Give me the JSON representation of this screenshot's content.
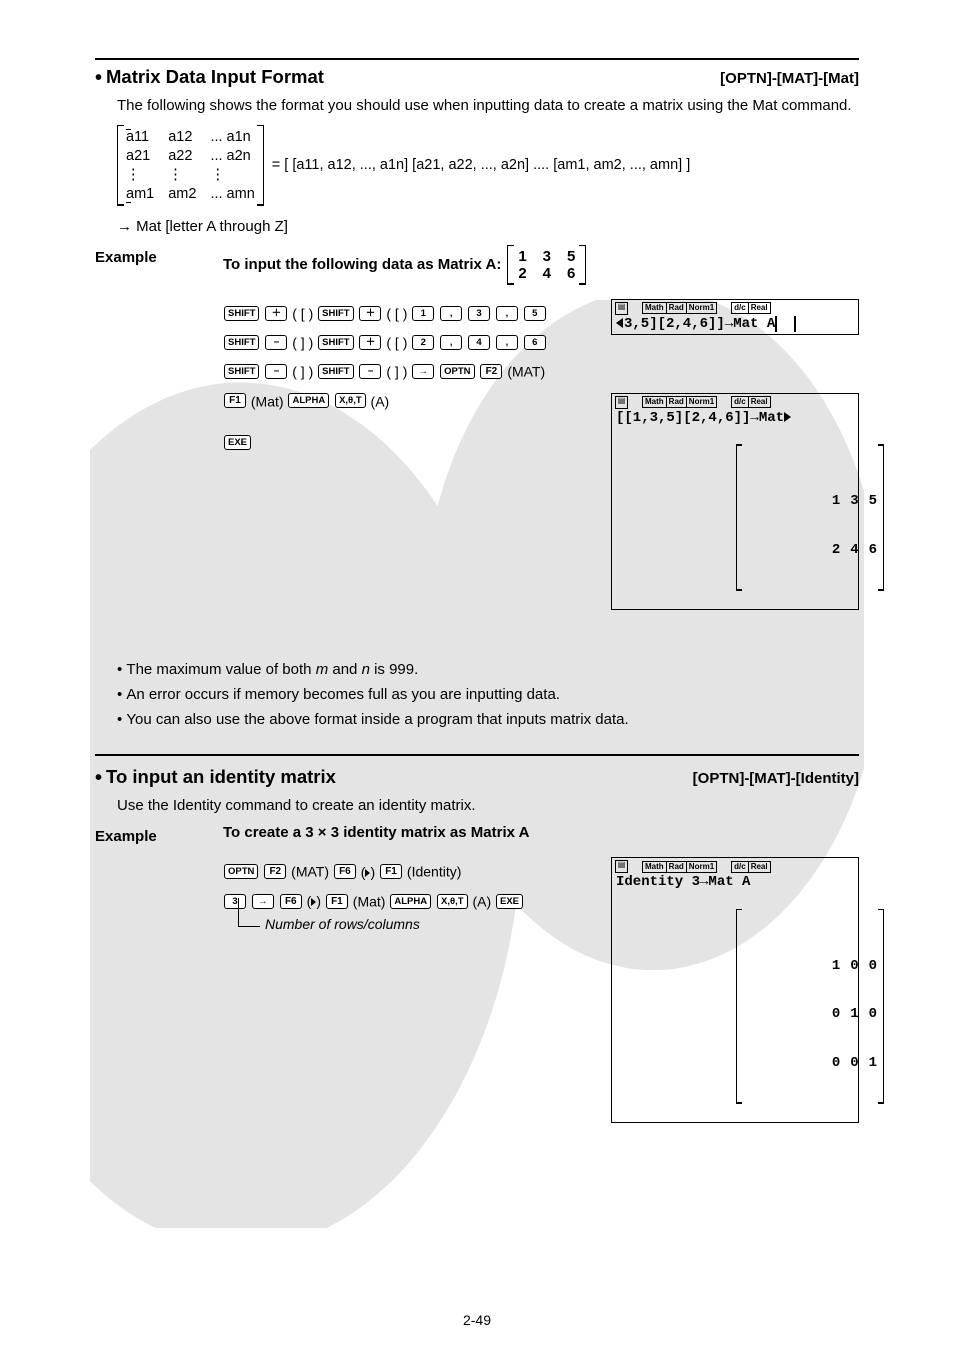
{
  "section1": {
    "title": "Matrix Data Input Format",
    "path": "[OPTN]-[MAT]-[Mat]",
    "intro": "The following shows the format you should use when inputting data to create a matrix using the Mat command.",
    "matrix_cells": [
      "a11",
      "a12",
      "... a1n",
      "a21",
      "a22",
      "... a2n",
      "⋮",
      "⋮",
      "      ⋮",
      "am1",
      "am2",
      "... amn"
    ],
    "rhs": "= [ [a11, a12, ..., a1n] [a21, a22, ..., a2n] .... [am1, am2, ..., amn] ]",
    "arrow_line": "→ Mat [letter A through Z]",
    "example_label": "Example",
    "example_prompt": "To input the following data as Matrix A:",
    "example_matrix": [
      [
        "1",
        "3",
        "5"
      ],
      [
        "2",
        "4",
        "6"
      ]
    ],
    "keylines": {
      "l1_part1": "( [ )",
      "l1_part2": "( [ )",
      "l2_part1": "( ] )",
      "l2_part2": "( [ )",
      "l3_part1": "( ] )",
      "l3_part2": "( ] )",
      "l3_suffix": "(MAT)",
      "l4_suffix": "(Mat)",
      "l4_end": "(A)"
    },
    "keys": {
      "shift": "SHIFT",
      "plus": "＋",
      "minus": "−",
      "one": "1",
      "two": "2",
      "three": "3",
      "four": "4",
      "five": "5",
      "six": "6",
      "comma": ",",
      "arrow": "→",
      "optn": "OPTN",
      "f1": "F1",
      "f2": "F2",
      "f6": "F6",
      "alpha": "ALPHA",
      "xot": "X,θ,T",
      "exe": "EXE"
    },
    "screen1": {
      "badges_a": [
        "Math",
        "Rad",
        "Norm1"
      ],
      "badges_b": [
        "d/c",
        "Real"
      ],
      "line": "3,5][2,4,6]]→Mat A"
    },
    "screen2": {
      "badges_a": [
        "Math",
        "Rad",
        "Norm1"
      ],
      "badges_b": [
        "d/c",
        "Real"
      ],
      "line1": "[[1,3,5][2,4,6]]→Mat",
      "result": [
        [
          "1",
          "3",
          "5"
        ],
        [
          "2",
          "4",
          "6"
        ]
      ]
    },
    "notes": [
      "The maximum value of both m and n is 999.",
      "An error occurs if memory becomes full as you are inputting data.",
      "You can also use the above format inside a program that inputs matrix data."
    ]
  },
  "section2": {
    "title": "To input an identity matrix",
    "path": "[OPTN]-[MAT]-[Identity]",
    "intro": "Use the Identity command to create an identity matrix.",
    "example_label": "Example",
    "example_prompt_a": "To create a 3",
    "example_prompt_b": "3 identity matrix as Matrix A",
    "line1_parts": {
      "mat": "(MAT)",
      "tri": "(▷)",
      "identity": "(Identity)"
    },
    "line2_parts": {
      "tri": "(▷)",
      "mat": "(Mat)",
      "a": "(A)"
    },
    "annot": "Number of rows/columns",
    "screen": {
      "badges_a": [
        "Math",
        "Rad",
        "Norm1"
      ],
      "badges_b": [
        "d/c",
        "Real"
      ],
      "line": "Identity 3→Mat A",
      "result": [
        [
          "1",
          "0",
          "0"
        ],
        [
          "0",
          "1",
          "0"
        ],
        [
          "0",
          "0",
          "1"
        ]
      ]
    }
  },
  "pagenum": "2-49"
}
